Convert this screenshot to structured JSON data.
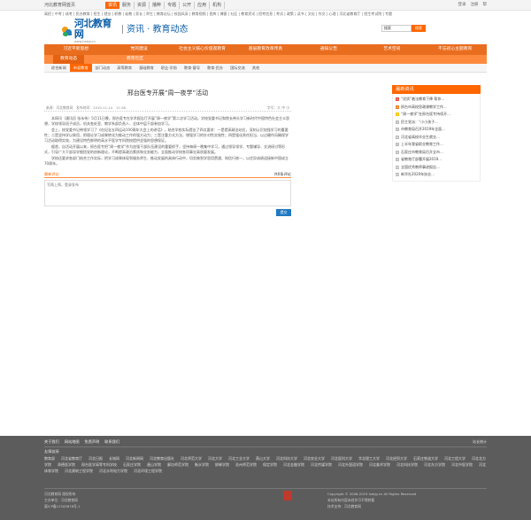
{
  "topbar": {
    "site": "河北教育网首页",
    "nav": [
      "资讯",
      "服务",
      "资源",
      "播粹",
      "专题",
      "公开",
      "应用",
      "机构"
    ],
    "util": [
      "登录",
      "注册",
      "帮"
    ]
  },
  "sublinks": "高招 | 中考 | 成考 | 民办教育 | 招生 | 就业 | 职教 | 幼教 | 家长 | 师生 | 教育论坛 | 校园风采 | 教育视频 | 图库 | 博客 | 社区 | 教育资讯 | 招考信息 | 考试 | 政策 | 读书 | 文化 | 作文 | 心理 | 河北省教育厅 | 招生考试院 | 专题",
  "header": {
    "logo_cn": "河北教育网",
    "logo_url": "www.hebjy.cn",
    "channel": "资讯 · 教育动态"
  },
  "search": {
    "value": "搜索",
    "button": "搜索"
  },
  "mainnav": [
    "习近平新思想",
    "党的建设",
    "社会主义核心价值观教育",
    "基层教育改革传真",
    "通知公告",
    "艺术空间",
    "不忘初心主题教育"
  ],
  "mainnav2": [
    "教育动态",
    "教育社区"
  ],
  "subnav": [
    "综合新闻",
    "市县教育",
    "部门动态",
    "高等教育",
    "基础教育",
    "职业·学前",
    "教育·督导",
    "教育·民办",
    "国际交流",
    "其他"
  ],
  "article": {
    "title": "邢台医专开展“周一夜学”活动",
    "meta_left": "来源：河北教育网　发布时间：2019-11-14　11:38",
    "meta_right": "字号：大 中 小",
    "paragraphs": [
      "本网讯（通讯员 张永伟）5月11日晚，邢台医专在学术报告厅开展“周一夜学”第二次学习活动。学校党委书记和院长带头学习新时代中国特色社会主义思想，学校领导班子成员，机关各处室、教学系部负责人、全体中层干部参加学习。",
      "会上，校党委书记带领学习了《在纪念五四运动100周年大会上的讲话》，结合学校实际提出了四点要求：一是提高政治站位，深刻认识加强学习的重要性；二是坚持学以致用，把理论学习成果转化为推动工作的强大动力；三是注重方式方法，增强学习的针对性实效性；四是强化责任担当，以过硬作风确保学习活动取得实效，为建设特色鲜明的高水平医学专科院校提供坚强的思想保证。",
      "据悉，自活动开展以来，邢台医专把“周一夜学”作为加强干部队伍建设的重要抓手，坚持每周一晚集中学习，通过领导领学、专题辅导、交流研讨等形式，引导广大干部深学细悟党的创新理论，不断提高政治素质和业务能力，全面推动学校各项事业高质量发展。",
      "学校还要求各部门结合工作实际，把学习成果体现到服务师生、推动发展的具体行动中，切实做到学思用贯通、知信行统一，以优异成绩迎接新中国成立70周年。"
    ]
  },
  "comment": {
    "title": "最新评论",
    "count": "共0条评论",
    "placeholder": "写两上两，登录发布",
    "button": "提交"
  },
  "sidebar": {
    "title": "最新资讯",
    "items": [
      "“优质”着法教育下降 帮你…",
      "邢台市高校思政课教学工作…",
      "“周一夜学”在邢台医专持续开…",
      "民主党派：“小小孩子…",
      "市教育局召开2019年全面…",
      "河北省高校毕业生就业…",
      "上半年我省职业教育工作…",
      "石家庄市教育局召开全市…",
      "省教育厅部署开展2019…",
      "全国优秀教师事迹报告…",
      "新华社2020年执业…"
    ]
  },
  "footer": {
    "links": [
      "关于我们",
      "网站地图",
      "免责声明",
      "联系我们"
    ],
    "stat": "站长统计",
    "partners_label": "友情链接",
    "partners": [
      "教育部",
      "河北省教育厅",
      "河北日报",
      "长城网",
      "河北新闻网",
      "河北教育出版社",
      "河北师范大学",
      "河北大学",
      "河北工业大学",
      "燕山大学",
      "河北科技大学",
      "河北农业大学",
      "河北医科大学",
      "华北理工大学",
      "河北经贸大学",
      "石家庄铁道大学",
      "河北工程大学",
      "河北北方学院",
      "承德医学院",
      "邢台医学高等专科学校",
      "石家庄学院",
      "唐山学院",
      "廊坊师范学院",
      "衡水学院",
      "邯郸学院",
      "沧州师范学院",
      "保定学院",
      "河北金融学院",
      "河北传媒学院",
      "河北外国语学院",
      "河北美术学院",
      "河北科技学院",
      "河北东方学院",
      "河北中医学院",
      "河北体育学院",
      "河北建筑工程学院",
      "河北水利电力学院",
      "河北环境工程学院"
    ],
    "left": [
      "河北教育网 版权所有",
      "主办单位：河北教育网",
      "冀ICP备12345678号-1"
    ],
    "right": [
      "Copyright © 2008-2019 hebjy.cn All Rights Reserved",
      "本站所有内容未经许可不得转载",
      "技术支持：河北教育网"
    ]
  }
}
